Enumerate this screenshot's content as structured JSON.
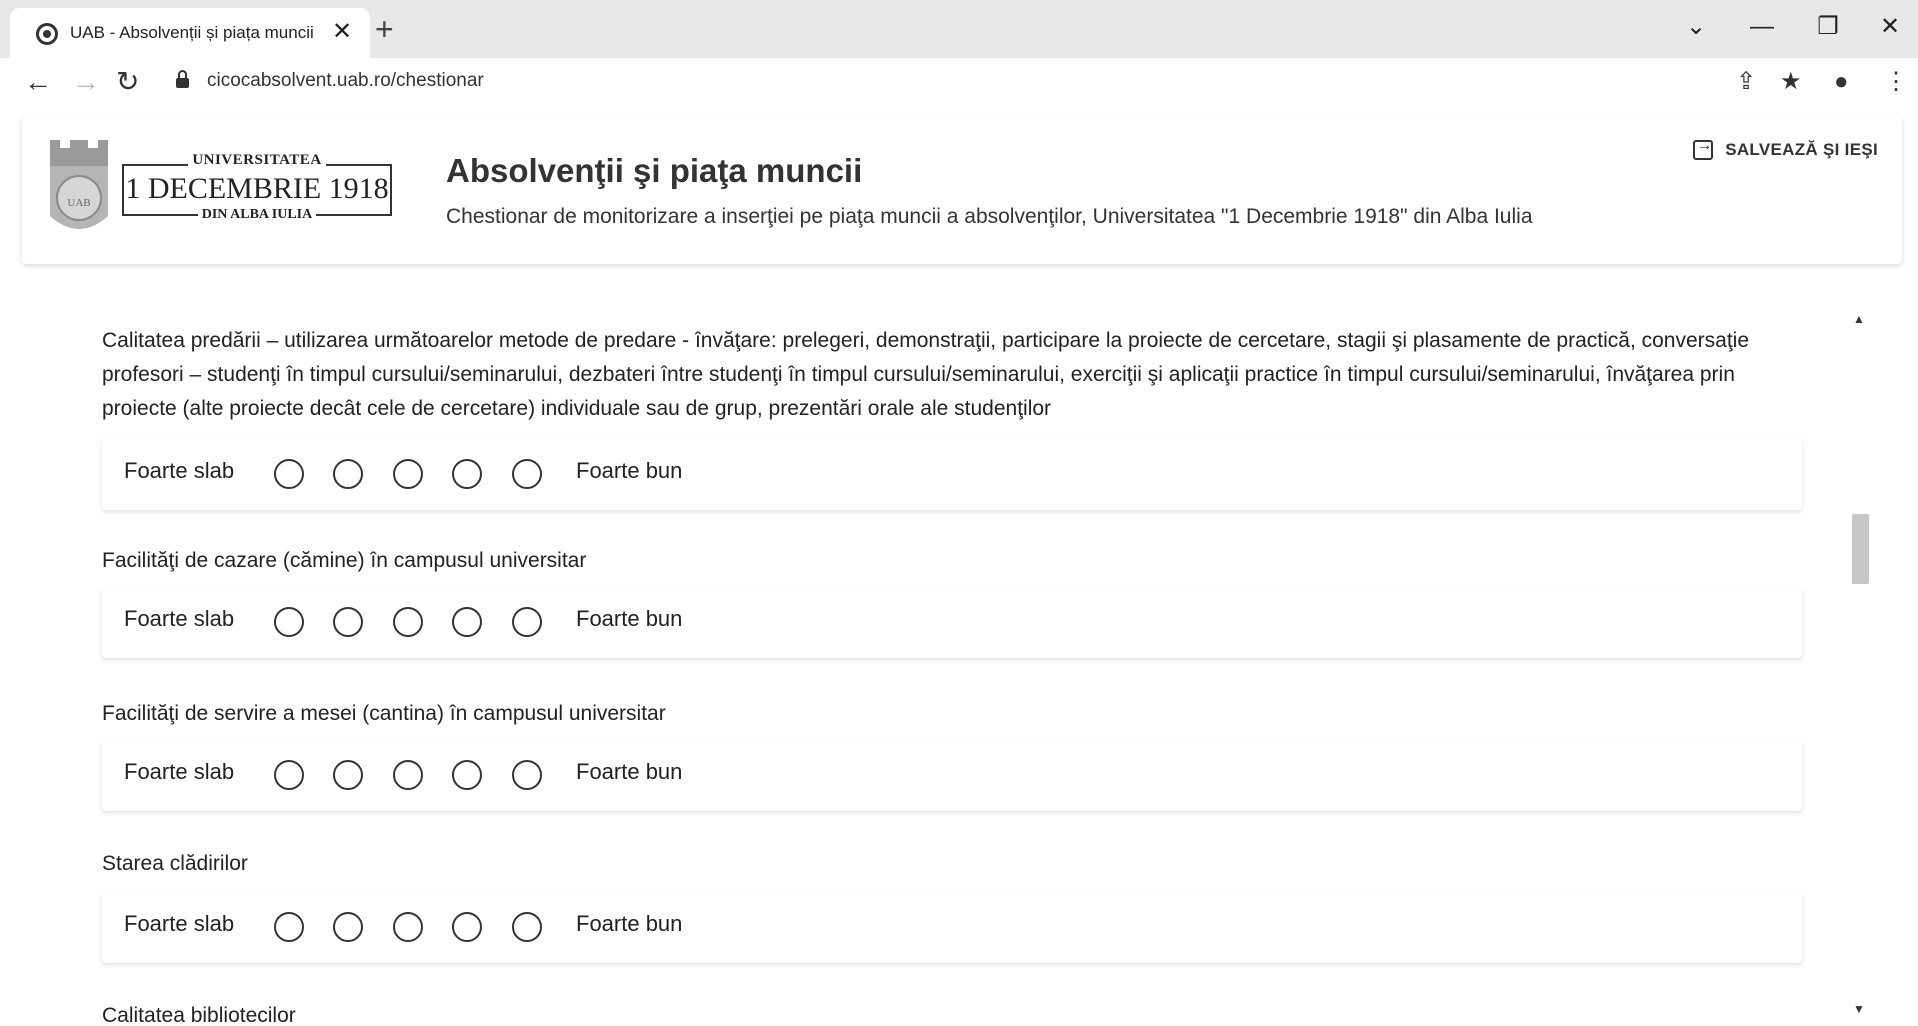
{
  "browser": {
    "tab_title": "UAB - Absolvenții și piața muncii",
    "tab_close": "✕",
    "new_tab": "+",
    "url": "cicocabsolvent.uab.ro/chestionar",
    "icons": [
      "back-icon",
      "forward-icon",
      "reload-icon",
      "lock-icon",
      "share-icon",
      "star-icon",
      "profile-icon",
      "menu-icon"
    ],
    "window_controls": [
      "⌄",
      "—",
      "❐",
      "✕"
    ]
  },
  "header": {
    "logo": {
      "top": "UNIVERSITATEA",
      "main": "1 DECEMBRIE 1918",
      "bottom": "DIN ALBA IULIA",
      "seal_text": "UAB"
    },
    "title": "Absolvenţii şi piaţa muncii",
    "subtitle": "Chestionar de monitorizare a inserţiei pe piaţa muncii a absolvenţilor, Universitatea \"1 Decembrie 1918\" din Alba Iulia",
    "save_exit_label": "SALVEAZĂ ŞI IEŞI"
  },
  "questions": [
    {
      "text": "Calitatea predării – utilizarea următoarelor metode de predare - învăţare: prelegeri, demonstraţii, participare la proiecte de cercetare, stagii şi plasamente de practică, conversaţie profesori – studenţi în timpul cursului/seminarului, dezbateri între studenţi în timpul cursului/seminarului, exerciţii şi aplicaţii practice în timpul cursului/seminarului, învăţarea prin proiecte (alte proiecte decât cele de cercetare) individuale sau de grup, prezentări orale ale studenţilor",
      "low_label": "Foarte slab",
      "high_label": "Foarte bun"
    },
    {
      "text": "Facilităţi de cazare (cămine) în campusul universitar",
      "low_label": "Foarte slab",
      "high_label": "Foarte bun"
    },
    {
      "text": "Facilităţi de servire a mesei (cantina) în campusul universitar",
      "low_label": "Foarte slab",
      "high_label": "Foarte bun"
    },
    {
      "text": "Starea clădirilor",
      "low_label": "Foarte slab",
      "high_label": "Foarte bun"
    }
  ],
  "next_question": "Calitatea bibliotecilor",
  "scrollbar": {
    "up": "▲",
    "down": "▼"
  }
}
